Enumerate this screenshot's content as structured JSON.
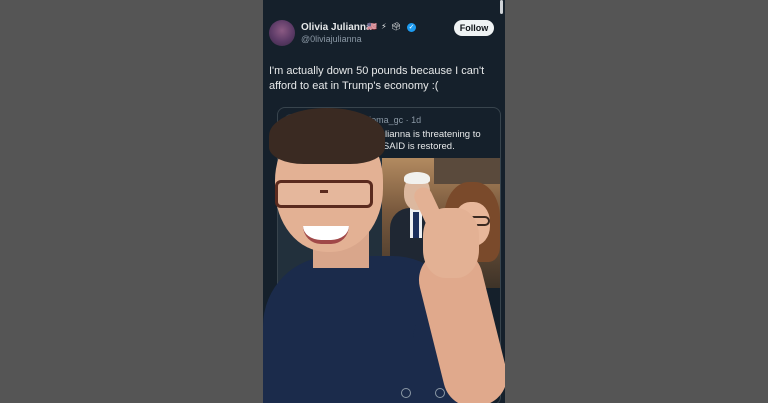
{
  "tweet": {
    "display_name": "Olivia Julianna",
    "emojis": "🇺🇸 ⚡ 🗳",
    "handle": "@0liviajulianna",
    "follow_label": "Follow",
    "text": "I'm actually down 50 pounds because I can't afford to eat in Trump's economy :("
  },
  "quote": {
    "handle_time": "@joma_gc · 1d",
    "text": "livia Julianna is threatening to until USAID is restored."
  },
  "colors": {
    "background": "#555555",
    "panel": "#15202b",
    "verified": "#1d9bf0"
  },
  "icons": [
    "verified-icon",
    "share-icon"
  ]
}
